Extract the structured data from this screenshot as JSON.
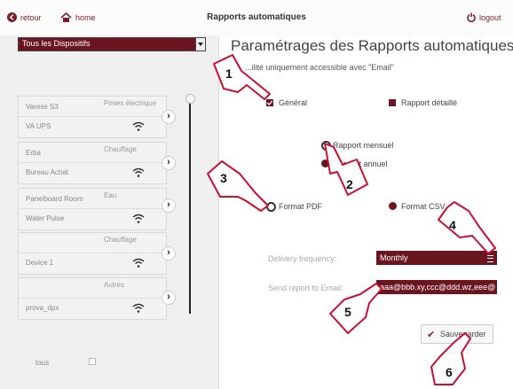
{
  "header": {
    "back_label": "retour",
    "home_label": "home",
    "title": "Rapports automatiques",
    "logout_label": "logout"
  },
  "sidebar": {
    "device_filter": "Tous les Dispositifs",
    "devices": [
      {
        "name": "Varese S3",
        "type": "Prises électrique",
        "sub": "VA UPS"
      },
      {
        "name": "Erba",
        "type": "Chauffage",
        "sub": "Bureau Achat"
      },
      {
        "name": "Paneiboard Room",
        "type": "Eau",
        "sub": "Water Pulse"
      },
      {
        "name": "",
        "type": "Chauffage",
        "sub": "Device 1"
      },
      {
        "name": "",
        "type": "Autres",
        "sub": "prova_dpx"
      }
    ],
    "all_label": "tous"
  },
  "main": {
    "heading": "Paramétrages des Rapports automatiques",
    "subtext": "...ilité uniquement accessible avec \"Email\"",
    "report_general_label": "Général",
    "report_detailed_label": "Rapport détaillé",
    "monthly_label": "Rapport mensuel",
    "annual_label": "Rapport annuel",
    "pdf_label": "Format PDF",
    "csv_label": "Format CSV",
    "frequency_label": "Delivery frequency:",
    "frequency_value": "Monthly",
    "email_label": "Send report to Email:",
    "email_value": "aaa@bbb.xy,ccc@ddd.wz,eee@",
    "save_label": "Sauvegarder"
  },
  "callouts": [
    "1",
    "2",
    "3",
    "4",
    "5",
    "6"
  ],
  "colors": {
    "accent": "#6a1520",
    "link": "#7a1f27",
    "callout_border": "#c8102e"
  }
}
